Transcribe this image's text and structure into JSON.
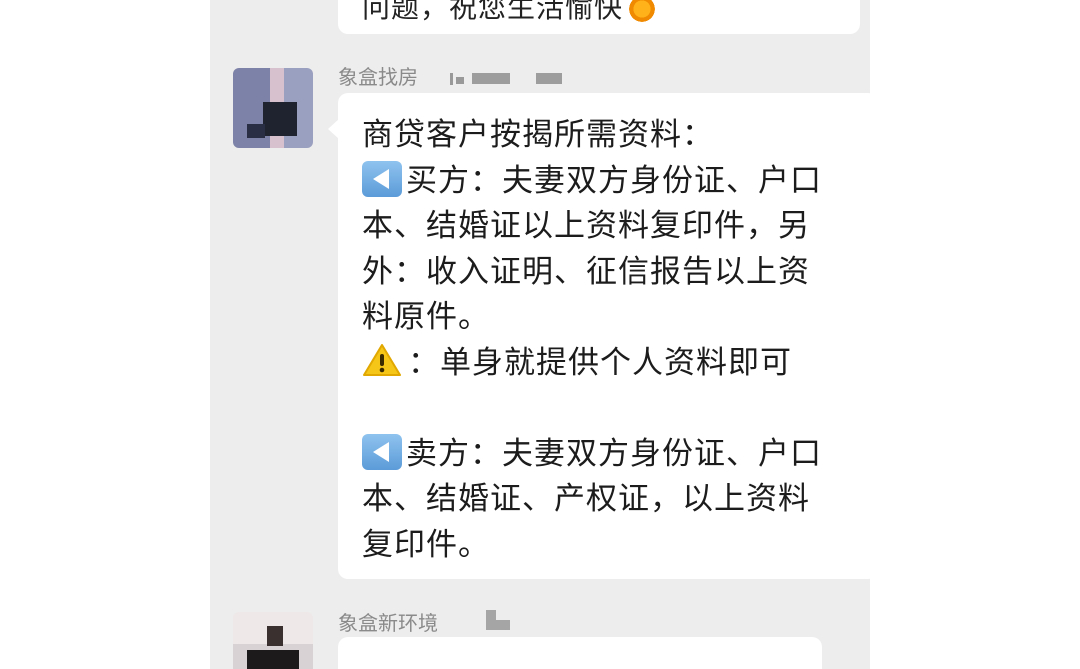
{
  "top_message": {
    "visible_text": "问题，祝您生活愉快",
    "icon": "sun-emoji-icon"
  },
  "message_1": {
    "sender": "象盒找房",
    "avatar": "avatar-blurred",
    "lines": [
      {
        "text": "商贷客户按揭所需资料："
      },
      {
        "icon": "arrow-left-icon",
        "text": "买方：夫妻双方身份证、户口"
      },
      {
        "text": "本、结婚证以上资料复印件，另"
      },
      {
        "text": "外：收入证明、征信报告以上资"
      },
      {
        "text": "料原件。"
      },
      {
        "icon": "warning-icon",
        "text": "：单身就提供个人资料即可"
      },
      {
        "text": ""
      },
      {
        "icon": "arrow-left-icon",
        "text": "卖方：夫妻双方身份证、户口"
      },
      {
        "text": "本、结婚证、产权证，以上资料"
      },
      {
        "text": "复印件。"
      }
    ]
  },
  "message_2": {
    "sender": "象盒新环境",
    "avatar": "avatar-blurred"
  },
  "colors": {
    "chat_background": "#ededed",
    "bubble": "#ffffff",
    "sender_text": "#8a8a8a",
    "arrow_icon": "#5b9bd8",
    "warning_icon": "#f5c518"
  }
}
